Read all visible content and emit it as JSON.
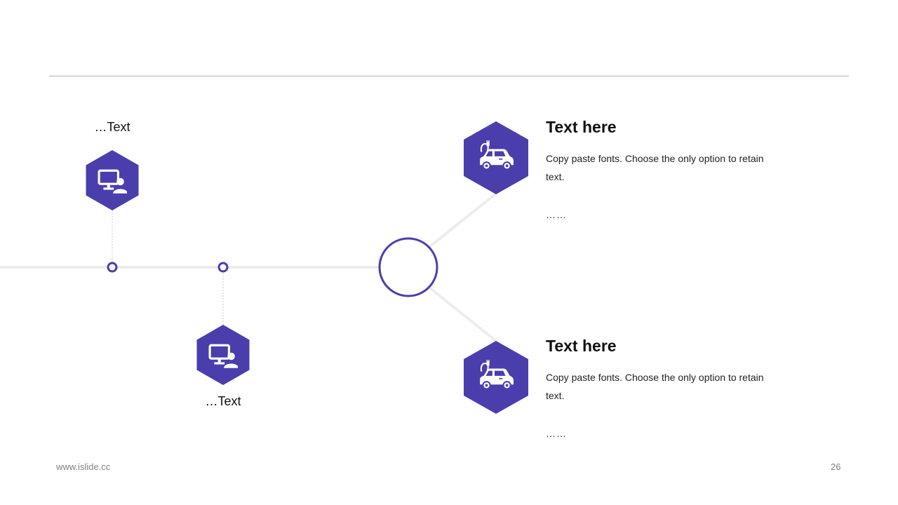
{
  "colors": {
    "accent": "#4a3ead",
    "rule": "#b3b3b3",
    "connector": "#ececec"
  },
  "left_nodes": [
    {
      "label": "…Text",
      "icon": "monitor-user-icon"
    },
    {
      "label": "…Text",
      "icon": "monitor-user-icon"
    }
  ],
  "hub": {
    "icon": "monitor-user-icon"
  },
  "right_items": [
    {
      "icon": "electric-car-icon",
      "heading": "Text here",
      "body": "Copy paste fonts. Choose the only option to retain text.",
      "more": "……"
    },
    {
      "icon": "electric-car-icon",
      "heading": "Text here",
      "body": "Copy paste fonts. Choose the only option to retain text.",
      "more": "……"
    }
  ],
  "footer": {
    "website": "www.islide.cc",
    "page_number": "26"
  }
}
